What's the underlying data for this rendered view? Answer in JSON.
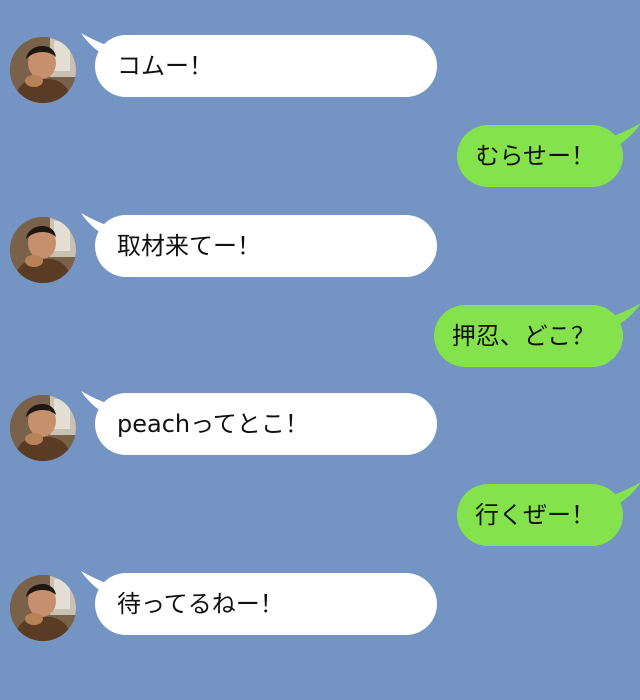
{
  "chat": {
    "background_color": "#7494c4",
    "incoming_bubble_color": "#ffffff",
    "outgoing_bubble_color": "#84e24c",
    "messages": [
      {
        "sender": "friend",
        "text": "コムー！"
      },
      {
        "sender": "me",
        "text": "むらせー！"
      },
      {
        "sender": "friend",
        "text": "取材来てー！"
      },
      {
        "sender": "me",
        "text": "押忍、どこ？"
      },
      {
        "sender": "friend",
        "text": "peachってとこ！"
      },
      {
        "sender": "me",
        "text": "行くぜー！"
      },
      {
        "sender": "friend",
        "text": "待ってるねー！"
      }
    ]
  }
}
